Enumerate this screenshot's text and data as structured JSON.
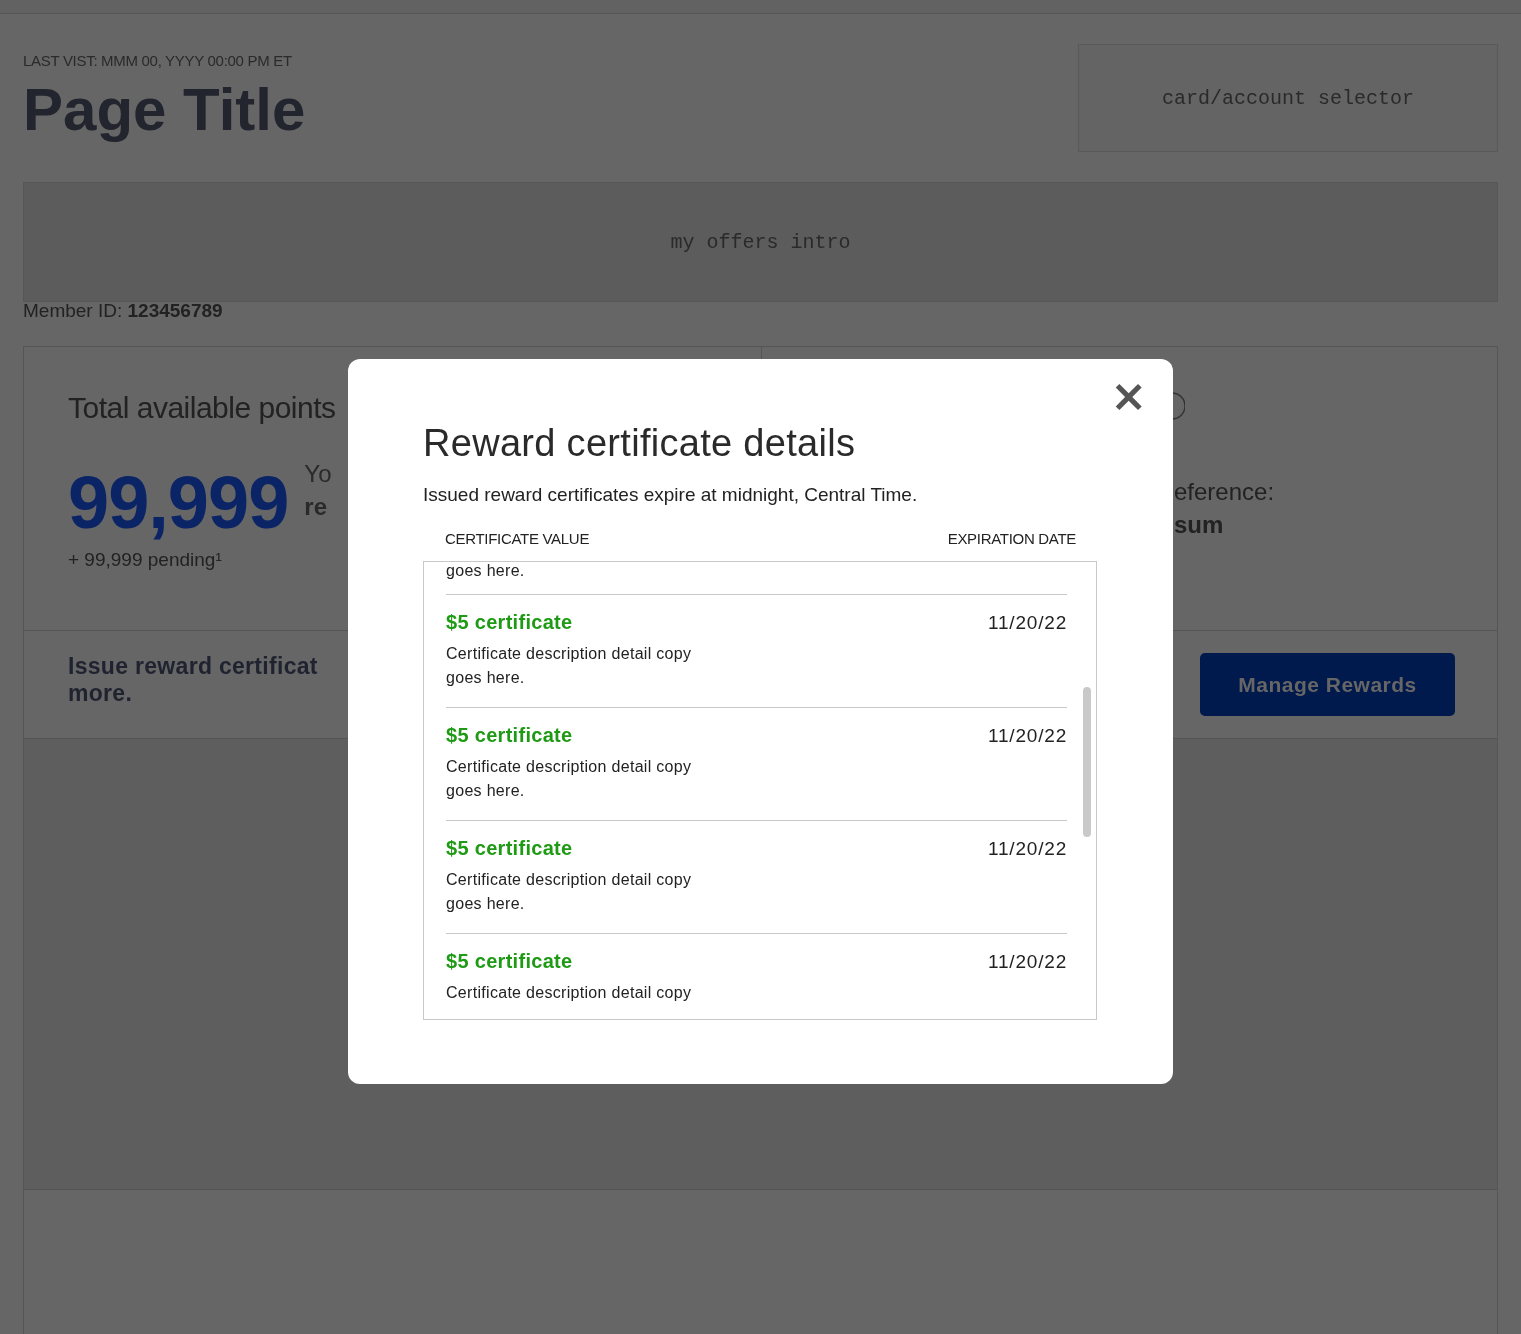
{
  "page": {
    "last_visit": "LAST VIST: MMM 00, YYYY 00:00 PM ET",
    "title": "Page Title",
    "selector_placeholder": "card/account selector",
    "intro_placeholder": "my offers intro",
    "member_id_label": "Member ID:",
    "member_id": "123456789"
  },
  "points_card": {
    "heading": "Total available points",
    "points": "99,999",
    "side_line_1": "Yo",
    "side_line_2": "re",
    "pending": "+ 99,999 pending¹",
    "issue_line_1": "Issue reward certificat",
    "issue_line_2": "more."
  },
  "preference_card": {
    "line_1": "eference:",
    "line_2": "sum",
    "button": "Manage Rewards"
  },
  "modal": {
    "close": "×",
    "title": "Reward certificate details",
    "subtitle": "Issued reward certificates expire at midnight, Central Time.",
    "columns": [
      "CERTIFICATE VALUE",
      "EXPIRATION DATE"
    ],
    "top_fragment": "goes here.",
    "certificates": [
      {
        "value": "$5 certificate",
        "date": "11/20/22",
        "description": "Certificate description detail copy goes here."
      },
      {
        "value": "$5 certificate",
        "date": "11/20/22",
        "description": "Certificate description detail copy goes here."
      },
      {
        "value": "$5 certificate",
        "date": "11/20/22",
        "description": "Certificate description detail copy goes here."
      },
      {
        "value": "$5 certificate",
        "date": "11/20/22",
        "description": "Certificate description detail copy"
      }
    ]
  }
}
